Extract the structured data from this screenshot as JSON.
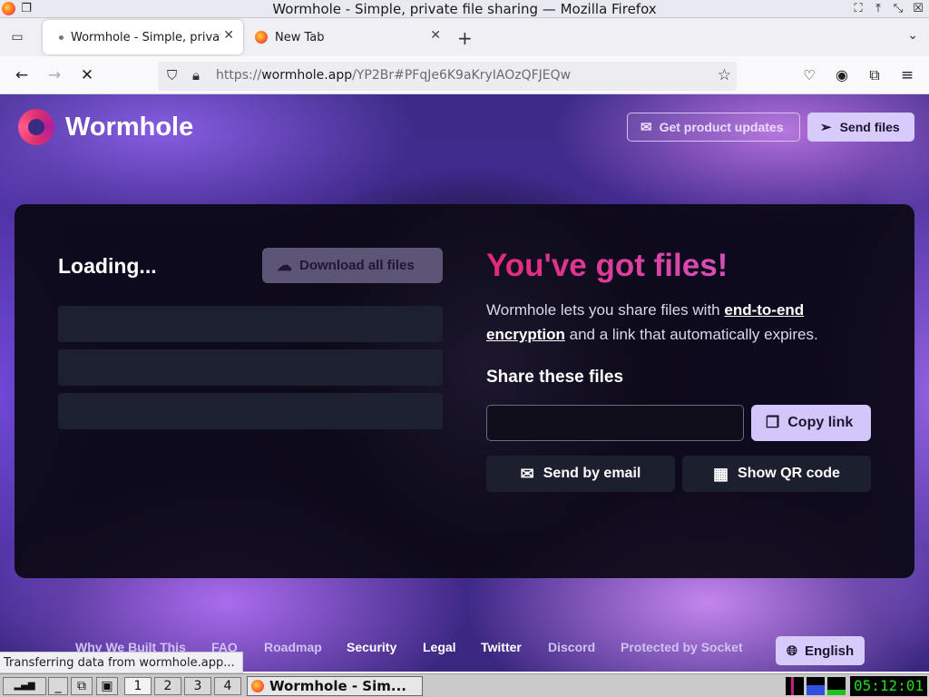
{
  "window": {
    "title": "Wormhole - Simple, private file sharing — Mozilla Firefox"
  },
  "tabs": [
    {
      "label": "Wormhole - Simple, private file sharing",
      "active": true
    },
    {
      "label": "New Tab",
      "active": false
    }
  ],
  "navbar": {
    "url_prefix": "https://",
    "url_domain": "wormhole.app",
    "url_path": "/YP2Br#PFqJe6K9aKryIAOzQFJEQw"
  },
  "page": {
    "brand": "Wormhole",
    "header_buttons": {
      "updates": "Get product updates",
      "send_files": "Send files"
    },
    "left_panel": {
      "loading": "Loading...",
      "download_all": "Download all files",
      "skeleton_rows": 3
    },
    "right_panel": {
      "headline": "You've got files!",
      "description_1": "Wormhole lets you share files with ",
      "description_link": "end-to-end encryption",
      "description_2": " and a link that automatically expires.",
      "share_label": "Share these files",
      "share_input_value": "",
      "copy_link": "Copy link",
      "send_by_email": "Send by email",
      "show_qr": "Show QR code"
    },
    "footer": {
      "links": [
        "Why We Built This",
        "FAQ",
        "Roadmap",
        "Security",
        "Legal",
        "Twitter",
        "Discord",
        "Protected by Socket"
      ],
      "language": "English"
    },
    "colors": {
      "accent_lavender": "#d7cbfb",
      "headline_pink": "#e2287a"
    }
  },
  "status_tooltip": "Transferring data from wormhole.app...",
  "taskbar": {
    "workspaces": [
      "1",
      "2",
      "3",
      "4"
    ],
    "active_window": "Wormhole - Sim...",
    "clock": "05:12:01"
  }
}
